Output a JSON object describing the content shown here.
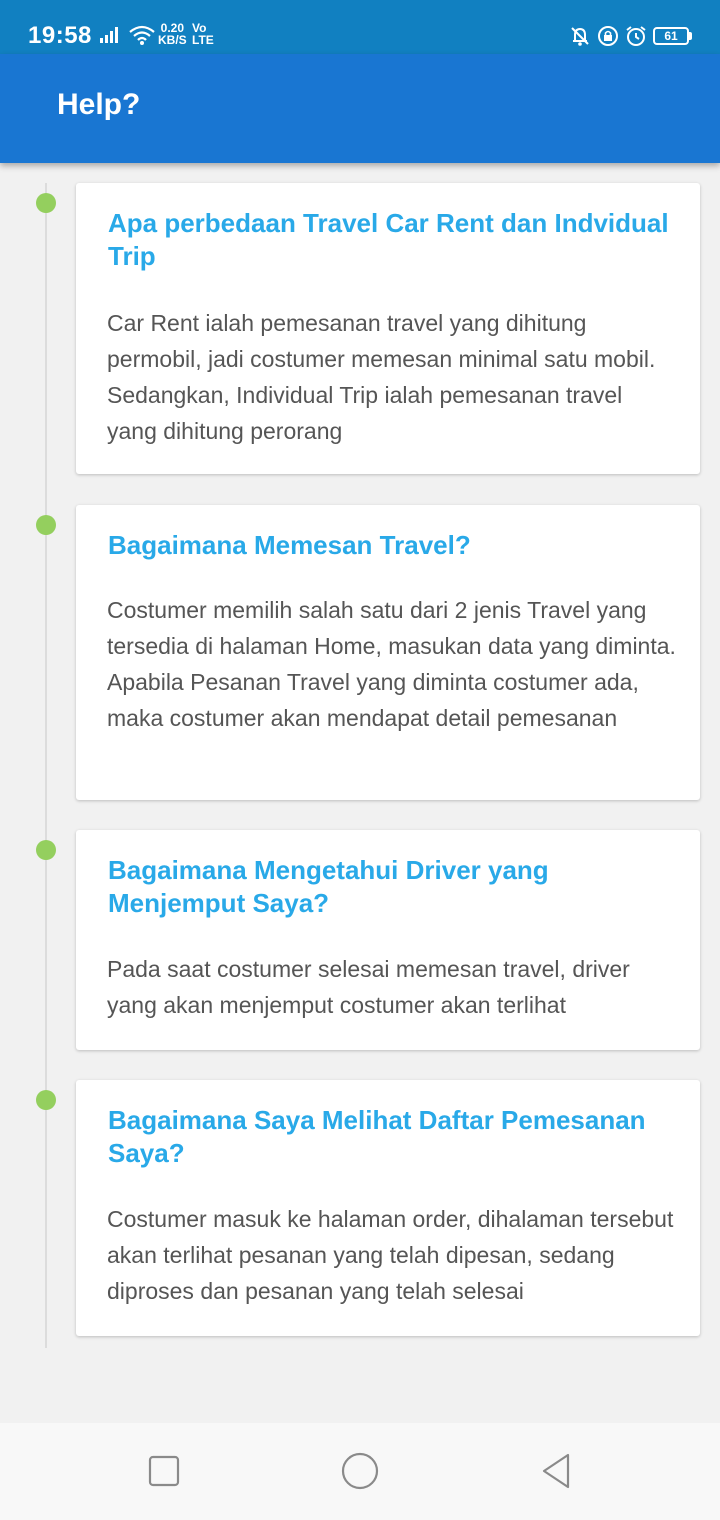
{
  "status_bar": {
    "time": "19:58",
    "net_speed_value": "0.20",
    "net_speed_unit": "KB/S",
    "volte_top": "Vo",
    "volte_bottom": "LTE",
    "battery": "61"
  },
  "app_bar": {
    "title": "Help?"
  },
  "faq": [
    {
      "question": "Apa perbedaan Travel Car Rent dan Indvidual Trip",
      "answer": "Car Rent ialah pemesanan travel yang dihitung permobil, jadi costumer memesan minimal satu mobil. Sedangkan, Individual Trip ialah pemesanan travel yang dihitung perorang"
    },
    {
      "question": "Bagaimana Memesan Travel?",
      "answer": "Costumer memilih salah satu dari 2 jenis Travel yang tersedia di halaman Home, masukan data yang diminta. Apabila Pesanan Travel yang diminta costumer ada, maka costumer akan mendapat detail pemesanan"
    },
    {
      "question": "Bagaimana Mengetahui Driver yang Menjemput Saya?",
      "answer": "Pada saat costumer selesai memesan travel, driver yang akan menjemput costumer akan terlihat"
    },
    {
      "question": "Bagaimana Saya Melihat Daftar Pemesanan Saya?",
      "answer": "Costumer masuk ke halaman order, dihalaman tersebut akan terlihat pesanan yang telah dipesan, sedang diproses dan pesanan yang telah selesai"
    }
  ],
  "colors": {
    "status_bar": "#1180c1",
    "app_bar": "#1976d2",
    "question": "#29a9e8",
    "answer": "#555555",
    "timeline_dot": "#94cf5e"
  },
  "icons": {
    "status_left": [
      "signal-icon",
      "wifi-icon"
    ],
    "status_right": [
      "bell-off-icon",
      "lock-icon",
      "alarm-icon",
      "battery-icon"
    ],
    "nav": [
      "recents-square-icon",
      "home-circle-icon",
      "back-triangle-icon"
    ]
  }
}
